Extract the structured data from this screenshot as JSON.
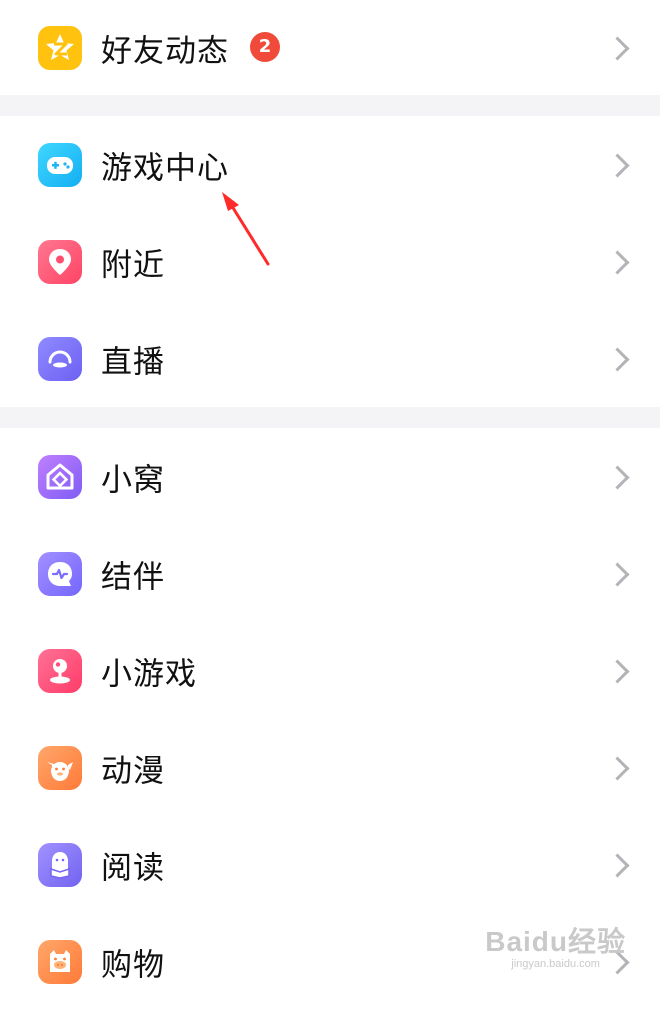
{
  "groups": [
    {
      "items": [
        {
          "label": "好友动态",
          "badge": "2",
          "icon": "qzone-star-icon",
          "colors": [
            "#ffd33d",
            "#ffb800"
          ]
        }
      ]
    },
    {
      "items": [
        {
          "label": "游戏中心",
          "icon": "gamepad-icon",
          "colors": [
            "#39d3ff",
            "#16b1f5"
          ]
        },
        {
          "label": "附近",
          "icon": "location-pin-icon",
          "colors": [
            "#ff6b86",
            "#ff4466"
          ]
        },
        {
          "label": "直播",
          "icon": "live-icon",
          "colors": [
            "#8a86ff",
            "#6f62f5"
          ]
        }
      ]
    },
    {
      "items": [
        {
          "label": "小窝",
          "icon": "home-icon",
          "colors": [
            "#b57cff",
            "#8a5cf6"
          ]
        },
        {
          "label": "结伴",
          "icon": "chat-bubble-icon",
          "colors": [
            "#9c8bff",
            "#7a6cff"
          ]
        },
        {
          "label": "小游戏",
          "icon": "joystick-icon",
          "colors": [
            "#ff6a8f",
            "#ff3f6c"
          ]
        },
        {
          "label": "动漫",
          "icon": "cartoon-face-icon",
          "colors": [
            "#ffa063",
            "#ff7c3a"
          ]
        },
        {
          "label": "阅读",
          "icon": "penguin-book-icon",
          "colors": [
            "#9b8cff",
            "#7566f3"
          ]
        },
        {
          "label": "购物",
          "icon": "shopping-bag-icon",
          "colors": [
            "#ffa063",
            "#ff7c3a"
          ]
        }
      ]
    }
  ],
  "annotation": {
    "color": "#ff2a2a"
  },
  "watermark": {
    "main": "Baidu经验",
    "sub": "jingyan.baidu.com"
  }
}
